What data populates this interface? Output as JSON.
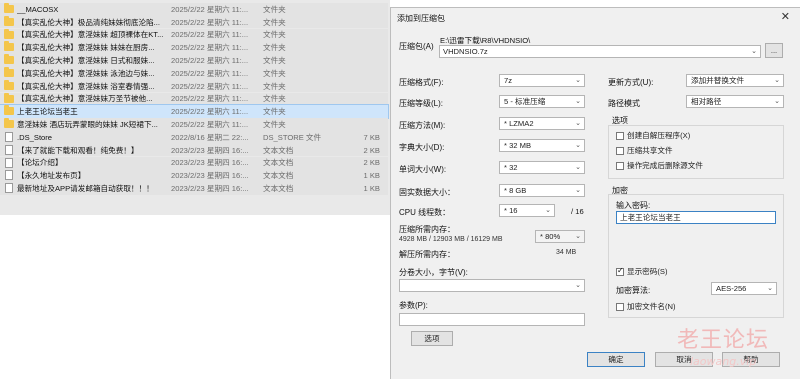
{
  "file_list": [
    {
      "icon": "folder-icon",
      "name": "__MACOSX",
      "date": "2025/2/22 星期六 11:...",
      "type": "文件夹",
      "size": "",
      "state": "dim"
    },
    {
      "icon": "folder-icon",
      "name": "【真实乱伦大神】极品清纯妹妹彻底沦陷...",
      "date": "2025/2/22 星期六 11:...",
      "type": "文件夹",
      "size": "",
      "state": "dim"
    },
    {
      "icon": "folder-icon",
      "name": "【真实乱伦大神】意淫妹妹 超顶裸体在KT...",
      "date": "2025/2/22 星期六 11:...",
      "type": "文件夹",
      "size": "",
      "state": "dim"
    },
    {
      "icon": "folder-icon",
      "name": "【真实乱伦大神】意淫妹妹 妹妹在厨房...",
      "date": "2025/2/22 星期六 11:...",
      "type": "文件夹",
      "size": "",
      "state": "dim"
    },
    {
      "icon": "folder-icon",
      "name": "【真实乱伦大神】意淫妹妹 日式和服妹...",
      "date": "2025/2/22 星期六 11:...",
      "type": "文件夹",
      "size": "",
      "state": "dim"
    },
    {
      "icon": "folder-icon",
      "name": "【真实乱伦大神】意淫妹妹 泳池边与妹...",
      "date": "2025/2/22 星期六 11:...",
      "type": "文件夹",
      "size": "",
      "state": "dim"
    },
    {
      "icon": "folder-icon",
      "name": "【真实乱伦大神】意淫妹妹 浴室春情强...",
      "date": "2025/2/22 星期六 11:...",
      "type": "文件夹",
      "size": "",
      "state": "dim"
    },
    {
      "icon": "folder-icon",
      "name": "【真实乱伦大神】意淫妹妹万圣节被他...",
      "date": "2025/2/22 星期六 11:...",
      "type": "文件夹",
      "size": "",
      "state": "dim"
    },
    {
      "icon": "folder-icon",
      "name": "上老王论坛当老王",
      "date": "2025/2/22 星期六 11:...",
      "type": "文件夹",
      "size": "",
      "state": "sel"
    },
    {
      "icon": "folder-icon",
      "name": "意淫妹妹  酒店玩弄蒙眼的妹妹 JK短裙下...",
      "date": "2025/2/22 星期六 11:...",
      "type": "文件夹",
      "size": "",
      "state": "dim"
    },
    {
      "icon": "doc-icon",
      "name": ".DS_Store",
      "date": "2022/8/16 星期二 22:...",
      "type": "DS_STORE 文件",
      "size": "7 KB",
      "state": "dim"
    },
    {
      "icon": "doc-icon",
      "name": "【来了就能下载和观看！纯免费！】",
      "date": "2023/2/23 星期四 16:...",
      "type": "文本文档",
      "size": "2 KB",
      "state": "dim"
    },
    {
      "icon": "doc-icon",
      "name": "【论坛介绍】",
      "date": "2023/2/23 星期四 16:...",
      "type": "文本文档",
      "size": "2 KB",
      "state": "dim"
    },
    {
      "icon": "doc-icon",
      "name": "【永久地址发布页】",
      "date": "2023/2/23 星期四 16:...",
      "type": "文本文档",
      "size": "1 KB",
      "state": "dim"
    },
    {
      "icon": "doc-icon",
      "name": "最新地址及APP请发邮箱自动获取！！！",
      "date": "2023/2/23 星期四 16:...",
      "type": "文本文档",
      "size": "1 KB",
      "state": "dim"
    }
  ],
  "dialog": {
    "title": "添加到压缩包",
    "close_glyph": "✕",
    "archive_label": "压缩包(A)",
    "archive_path": "E:\\迅雷下载\\R8\\VHDNSIO\\",
    "archive_name": "VHDNSIO.7z",
    "browse_label": "...",
    "format_label": "压缩格式(F):",
    "format_value": "7z",
    "level_label": "压缩等级(L):",
    "level_value": "5 - 标准压缩",
    "method_label": "压缩方法(M):",
    "method_value": "* LZMA2",
    "dict_label": "字典大小(D):",
    "dict_value": "* 32 MB",
    "word_label": "单词大小(W):",
    "word_value": "* 32",
    "solid_label": "固实数据大小：",
    "solid_value": "* 8 GB",
    "threads_label": "CPU 线程数：",
    "threads_value": "* 16",
    "threads_total": "/ 16",
    "mem_label": "压缩所需内存：",
    "mem_value": "4928 MB / 12903 MB / 16129 MB",
    "mem_percent": "* 80%",
    "decomp_label": "解压所需内存：",
    "decomp_value": "34 MB",
    "split_label": "分卷大小，字节(V):",
    "split_value": "",
    "params_label": "参数(P):",
    "params_value": "",
    "options_button": "选项",
    "update_label": "更新方式(U):",
    "update_value": "添加并替换文件",
    "path_label": "路径模式",
    "path_value": "相对路径",
    "options_group": "选项",
    "opt_sfx": "创建自解压程序(X)",
    "opt_shared": "压缩共享文件",
    "opt_delete": "操作完成后删除源文件",
    "enc_group": "加密",
    "password_label": "输入密码:",
    "password_value": "上老王论坛当老王",
    "show_password": "显示密码(S)",
    "enc_method_label": "加密算法:",
    "enc_method_value": "AES-256",
    "enc_names": "加密文件名(N)",
    "ok": "确定",
    "cancel": "取消",
    "help": "帮助",
    "dropdown_arrow": "⌄"
  },
  "watermark": {
    "title": "老王论坛",
    "url": "laowang.vip"
  }
}
